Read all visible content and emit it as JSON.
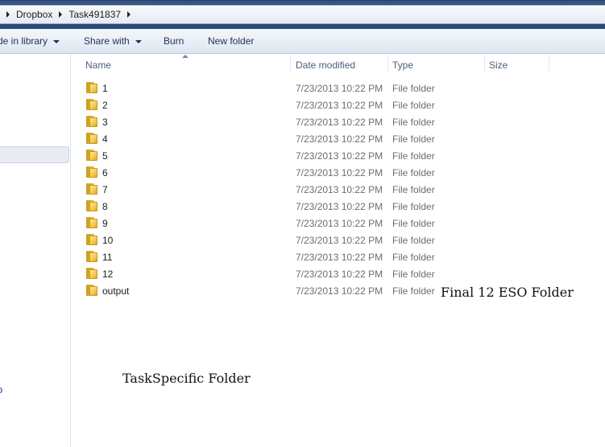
{
  "breadcrumb": {
    "items": [
      "Dropbox",
      "Task491837"
    ]
  },
  "toolbar": {
    "include_label": "de in library",
    "share_label": "Share with",
    "burn_label": "Burn",
    "new_folder_label": "New folder"
  },
  "columns": {
    "name": "Name",
    "date": "Date modified",
    "type": "Type",
    "size": "Size"
  },
  "files": [
    {
      "name": "1",
      "date": "7/23/2013 10:22 PM",
      "type": "File folder"
    },
    {
      "name": "2",
      "date": "7/23/2013 10:22 PM",
      "type": "File folder"
    },
    {
      "name": "3",
      "date": "7/23/2013 10:22 PM",
      "type": "File folder"
    },
    {
      "name": "4",
      "date": "7/23/2013 10:22 PM",
      "type": "File folder"
    },
    {
      "name": "5",
      "date": "7/23/2013 10:22 PM",
      "type": "File folder"
    },
    {
      "name": "6",
      "date": "7/23/2013 10:22 PM",
      "type": "File folder"
    },
    {
      "name": "7",
      "date": "7/23/2013 10:22 PM",
      "type": "File folder"
    },
    {
      "name": "8",
      "date": "7/23/2013 10:22 PM",
      "type": "File folder"
    },
    {
      "name": "9",
      "date": "7/23/2013 10:22 PM",
      "type": "File folder"
    },
    {
      "name": "10",
      "date": "7/23/2013 10:22 PM",
      "type": "File folder"
    },
    {
      "name": "11",
      "date": "7/23/2013 10:22 PM",
      "type": "File folder"
    },
    {
      "name": "12",
      "date": "7/23/2013 10:22 PM",
      "type": "File folder"
    },
    {
      "name": "output",
      "date": "7/23/2013 10:22 PM",
      "type": "File folder"
    }
  ],
  "annotations": {
    "output_note": "Final 12 ESO Folder",
    "task_note": "TaskSpecific Folder"
  },
  "icons": {
    "folder": "folder-icon",
    "breadcrumb_separator": "chevron-right-icon",
    "dropdown": "chevron-down-icon"
  },
  "nav": {
    "fragment": "o"
  }
}
